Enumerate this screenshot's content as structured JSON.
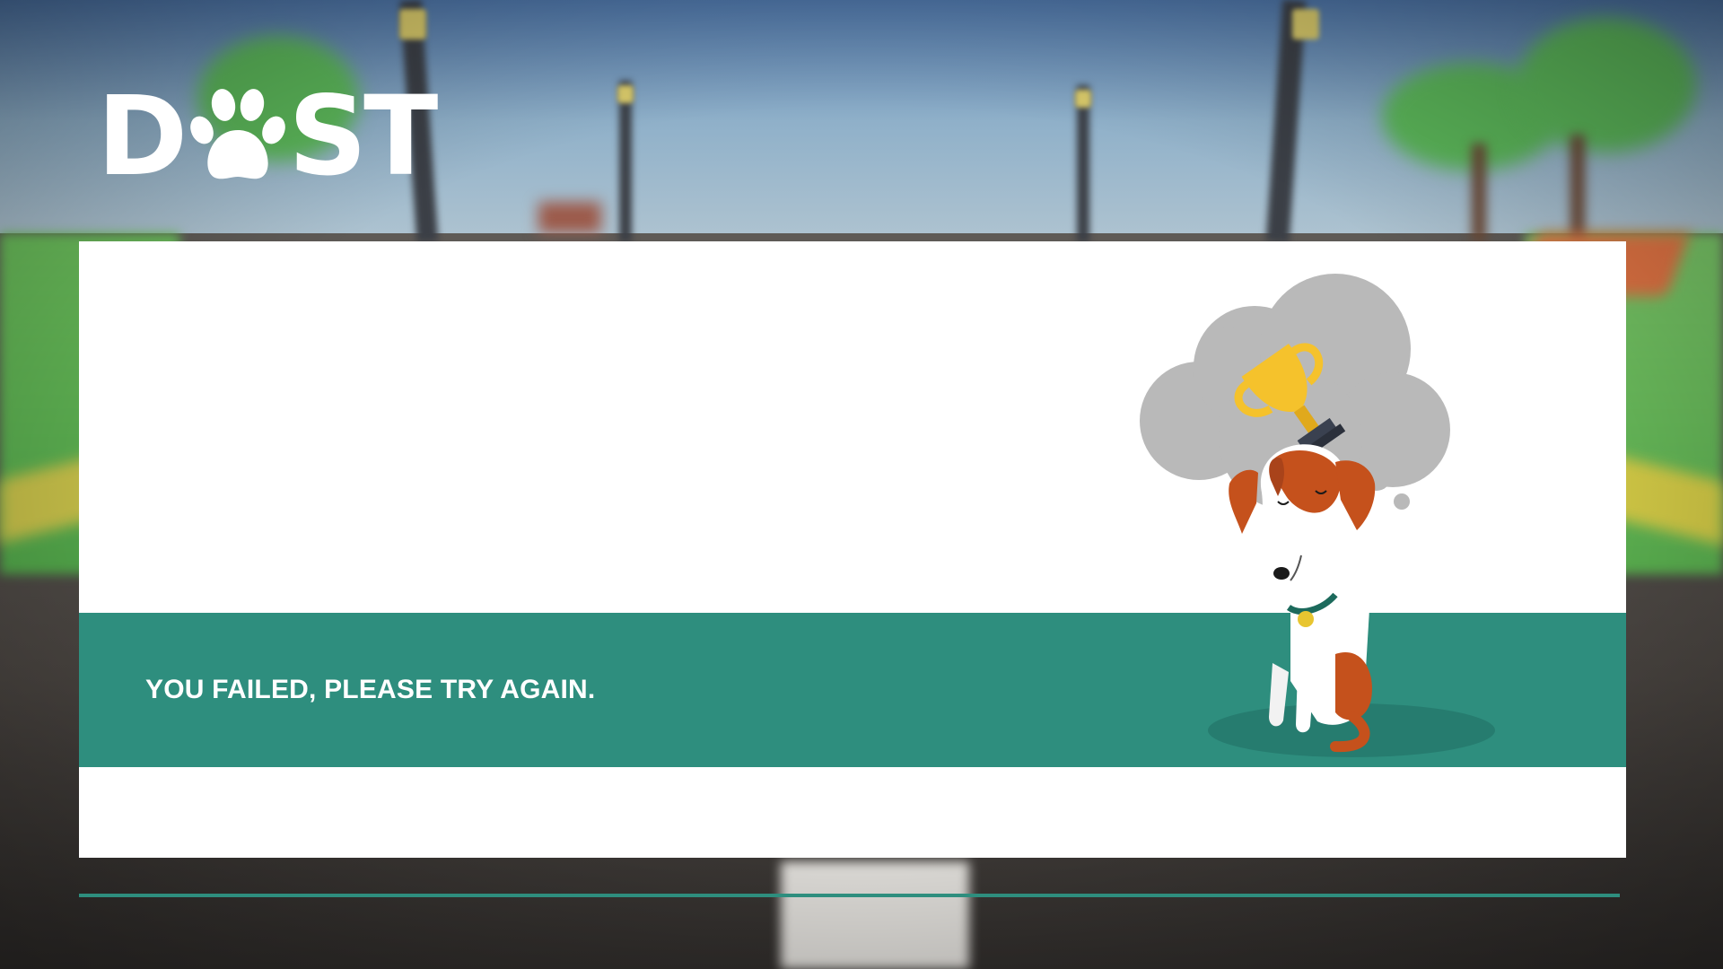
{
  "logo": {
    "text_left": "D",
    "text_right": "ST",
    "icon": "paw-icon"
  },
  "result": {
    "message": "YOU FAILED, PLEASE TRY AGAIN.",
    "status": "failed"
  },
  "illustration": {
    "subject": "sad-dog-icon",
    "thought": "trophy-icon"
  },
  "colors": {
    "accent": "#2e8e7e",
    "panel": "#ffffff",
    "dog_patch": "#c5511c",
    "trophy": "#f5c22c",
    "thought_cloud": "#b9b9b9"
  }
}
